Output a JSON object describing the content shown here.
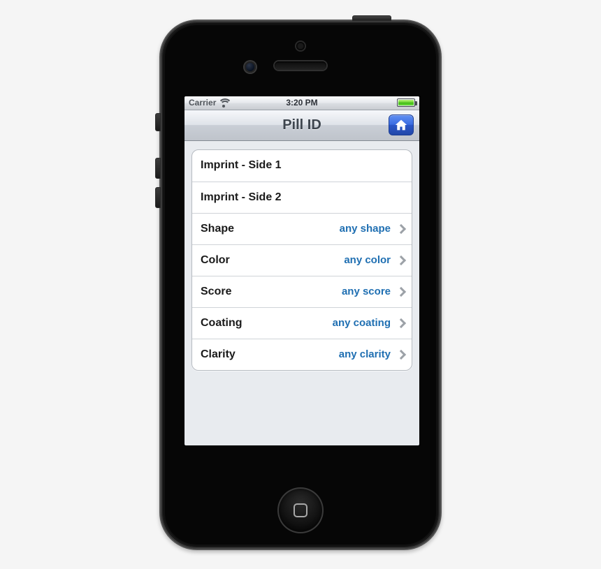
{
  "statusbar": {
    "carrier": "Carrier",
    "time": "3:20 PM"
  },
  "navbar": {
    "title": "Pill ID"
  },
  "rows": [
    {
      "label": "Imprint - Side 1",
      "value": "",
      "disclosure": false
    },
    {
      "label": "Imprint - Side 2",
      "value": "",
      "disclosure": false
    },
    {
      "label": "Shape",
      "value": "any shape",
      "disclosure": true
    },
    {
      "label": "Color",
      "value": "any color",
      "disclosure": true
    },
    {
      "label": "Score",
      "value": "any score",
      "disclosure": true
    },
    {
      "label": "Coating",
      "value": "any coating",
      "disclosure": true
    },
    {
      "label": "Clarity",
      "value": "any clarity",
      "disclosure": true
    }
  ]
}
